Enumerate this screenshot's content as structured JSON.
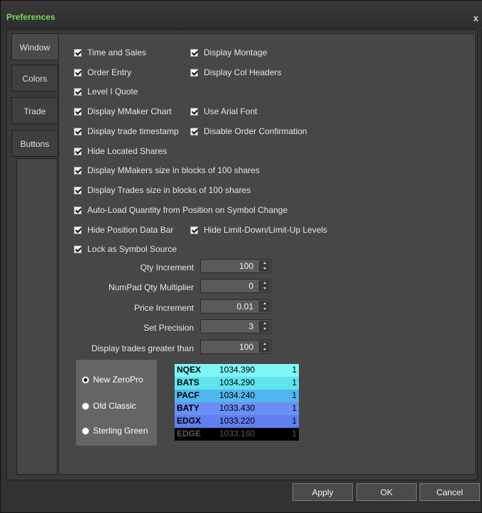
{
  "window": {
    "title": "Preferences",
    "close_glyph": "x"
  },
  "tabs": [
    {
      "label": "Window"
    },
    {
      "label": "Colors"
    },
    {
      "label": "Trade"
    },
    {
      "label": "Buttons"
    }
  ],
  "checkboxes": {
    "time_and_sales": {
      "label": "Time and Sales",
      "checked": true
    },
    "display_montage": {
      "label": "Display Montage",
      "checked": true
    },
    "order_entry": {
      "label": "Order Entry",
      "checked": true
    },
    "display_col_headers": {
      "label": "Display Col Headers",
      "checked": true
    },
    "level1_quote": {
      "label": "Level I Quote",
      "checked": true
    },
    "display_mmaker_chart": {
      "label": "Display MMaker Chart",
      "checked": true
    },
    "use_arial_font": {
      "label": "Use Arial Font",
      "checked": true
    },
    "display_trade_timestamp": {
      "label": "Display trade timestamp",
      "checked": true
    },
    "disable_order_confirmation": {
      "label": "Disable Order Confirmation",
      "checked": true
    },
    "hide_located_shares": {
      "label": "Hide Located Shares",
      "checked": true
    },
    "mmakers_size_blocks": {
      "label": "Display MMakers size in blocks of 100 shares",
      "checked": true
    },
    "trades_size_blocks": {
      "label": "Display Trades size in blocks of 100 shares",
      "checked": true
    },
    "auto_load_quantity": {
      "label": "Auto-Load Quantity from Position on Symbol Change",
      "checked": true
    },
    "hide_position_data_bar": {
      "label": "Hide Position Data Bar",
      "checked": true
    },
    "hide_limit_levels": {
      "label": "Hide Limit-Down/Limit-Up Levels",
      "checked": true
    },
    "lock_symbol_source": {
      "label": "Lock as Symbol Source",
      "checked": true
    }
  },
  "spinners": {
    "qty_increment": {
      "label": "Qty Increment",
      "value": "100"
    },
    "numpad_qty_multiplier": {
      "label": "NumPad Qty Multiplier",
      "value": "0"
    },
    "price_increment": {
      "label": "Price Increment",
      "value": "0.01"
    },
    "set_precision": {
      "label": "Set Precision",
      "value": "3"
    },
    "display_trades_greater": {
      "label": "Display trades greater than",
      "value": "100"
    }
  },
  "themes": {
    "selected": "New ZeroPro",
    "options": [
      {
        "label": "New ZeroPro"
      },
      {
        "label": "Old Classic"
      },
      {
        "label": "Sterling Green"
      }
    ]
  },
  "preview": {
    "rows": [
      {
        "exchange": "NQEX",
        "price": "1034.390",
        "size": "1",
        "bg": "#7ef7f7",
        "fg": "#000000"
      },
      {
        "exchange": "BATS",
        "price": "1034.290",
        "size": "1",
        "bg": "#5fe3ee",
        "fg": "#000000"
      },
      {
        "exchange": "PACF",
        "price": "1034.240",
        "size": "1",
        "bg": "#52b6ee",
        "fg": "#000000"
      },
      {
        "exchange": "BATY",
        "price": "1033.430",
        "size": "1",
        "bg": "#6b8ff5",
        "fg": "#000000"
      },
      {
        "exchange": "EDGX",
        "price": "1033.220",
        "size": "1",
        "bg": "#5f7ff0",
        "fg": "#000000"
      },
      {
        "exchange": "EDGE",
        "price": "1033.160",
        "size": "1",
        "bg": "#000000",
        "fg": "#5a5a5a"
      }
    ]
  },
  "buttons": {
    "apply": "Apply",
    "ok": "OK",
    "cancel": "Cancel"
  },
  "colors": {
    "title_green": "#7fd957",
    "panel": "#474747"
  }
}
